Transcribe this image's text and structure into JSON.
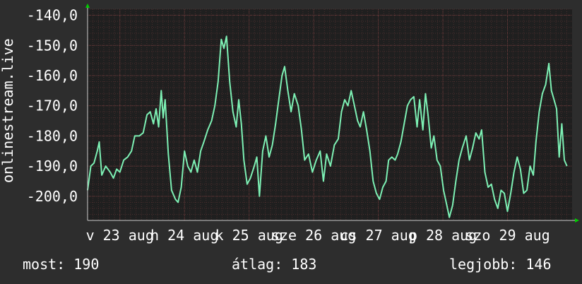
{
  "chart_data": {
    "type": "line",
    "title": "",
    "ylabel": "onlinestream.live",
    "xlabel": "",
    "ylim": [
      -208,
      -138
    ],
    "y_ticks": [
      "-140,0",
      "-150,0",
      "-160,0",
      "-170,0",
      "-180,0",
      "-190,0",
      "-200,0"
    ],
    "y_tick_values": [
      -140,
      -150,
      -160,
      -170,
      -180,
      -190,
      -200
    ],
    "x_range": [
      0,
      7.5
    ],
    "x_labels": [
      {
        "label": "v 23 aug",
        "x": 0.5
      },
      {
        "label": "h 24 aug",
        "x": 1.5
      },
      {
        "label": "k 25 aug",
        "x": 2.5
      },
      {
        "label": "sze 26 aug",
        "x": 3.5
      },
      {
        "label": "cs 27 aug",
        "x": 4.5
      },
      {
        "label": "p 28 aug",
        "x": 5.5
      },
      {
        "label": "szo 29 aug",
        "x": 6.5
      }
    ],
    "grid": true,
    "series": [
      {
        "color": "#7df0b4",
        "points": [
          [
            0.0,
            -198
          ],
          [
            0.05,
            -190
          ],
          [
            0.1,
            -189
          ],
          [
            0.15,
            -185
          ],
          [
            0.18,
            -182
          ],
          [
            0.22,
            -193
          ],
          [
            0.28,
            -190
          ],
          [
            0.35,
            -192
          ],
          [
            0.4,
            -194
          ],
          [
            0.45,
            -191
          ],
          [
            0.5,
            -192
          ],
          [
            0.56,
            -188
          ],
          [
            0.62,
            -187
          ],
          [
            0.68,
            -185
          ],
          [
            0.73,
            -180
          ],
          [
            0.8,
            -180
          ],
          [
            0.86,
            -179
          ],
          [
            0.92,
            -173
          ],
          [
            0.97,
            -172
          ],
          [
            1.02,
            -176
          ],
          [
            1.06,
            -171
          ],
          [
            1.1,
            -177
          ],
          [
            1.14,
            -165
          ],
          [
            1.17,
            -174
          ],
          [
            1.2,
            -168
          ],
          [
            1.25,
            -186
          ],
          [
            1.3,
            -198
          ],
          [
            1.36,
            -201
          ],
          [
            1.4,
            -202
          ],
          [
            1.45,
            -197
          ],
          [
            1.5,
            -185
          ],
          [
            1.55,
            -190
          ],
          [
            1.6,
            -192
          ],
          [
            1.65,
            -188
          ],
          [
            1.7,
            -192
          ],
          [
            1.75,
            -185
          ],
          [
            1.8,
            -182
          ],
          [
            1.86,
            -178
          ],
          [
            1.92,
            -175
          ],
          [
            1.97,
            -170
          ],
          [
            2.02,
            -162
          ],
          [
            2.07,
            -148
          ],
          [
            2.11,
            -151
          ],
          [
            2.15,
            -147
          ],
          [
            2.2,
            -162
          ],
          [
            2.25,
            -172
          ],
          [
            2.3,
            -177
          ],
          [
            2.34,
            -168
          ],
          [
            2.38,
            -176
          ],
          [
            2.42,
            -188
          ],
          [
            2.47,
            -196
          ],
          [
            2.52,
            -194
          ],
          [
            2.58,
            -190
          ],
          [
            2.62,
            -187
          ],
          [
            2.66,
            -200
          ],
          [
            2.71,
            -185
          ],
          [
            2.76,
            -180
          ],
          [
            2.81,
            -187
          ],
          [
            2.86,
            -183
          ],
          [
            2.91,
            -176
          ],
          [
            2.96,
            -168
          ],
          [
            3.01,
            -160
          ],
          [
            3.05,
            -157
          ],
          [
            3.1,
            -165
          ],
          [
            3.15,
            -172
          ],
          [
            3.2,
            -166
          ],
          [
            3.26,
            -170
          ],
          [
            3.31,
            -178
          ],
          [
            3.36,
            -188
          ],
          [
            3.42,
            -186
          ],
          [
            3.48,
            -192
          ],
          [
            3.54,
            -188
          ],
          [
            3.6,
            -185
          ],
          [
            3.65,
            -195
          ],
          [
            3.7,
            -186
          ],
          [
            3.76,
            -190
          ],
          [
            3.82,
            -183
          ],
          [
            3.88,
            -181
          ],
          [
            3.93,
            -172
          ],
          [
            3.98,
            -168
          ],
          [
            4.03,
            -170
          ],
          [
            4.08,
            -165
          ],
          [
            4.13,
            -170
          ],
          [
            4.18,
            -175
          ],
          [
            4.22,
            -177
          ],
          [
            4.27,
            -172
          ],
          [
            4.32,
            -178
          ],
          [
            4.37,
            -185
          ],
          [
            4.42,
            -195
          ],
          [
            4.47,
            -199
          ],
          [
            4.52,
            -201
          ],
          [
            4.57,
            -197
          ],
          [
            4.62,
            -195
          ],
          [
            4.66,
            -188
          ],
          [
            4.71,
            -187
          ],
          [
            4.76,
            -188
          ],
          [
            4.8,
            -186
          ],
          [
            4.85,
            -182
          ],
          [
            4.9,
            -176
          ],
          [
            4.95,
            -170
          ],
          [
            5.0,
            -168
          ],
          [
            5.05,
            -167
          ],
          [
            5.1,
            -177
          ],
          [
            5.14,
            -168
          ],
          [
            5.19,
            -178
          ],
          [
            5.23,
            -166
          ],
          [
            5.27,
            -173
          ],
          [
            5.32,
            -184
          ],
          [
            5.36,
            -180
          ],
          [
            5.41,
            -188
          ],
          [
            5.46,
            -190
          ],
          [
            5.51,
            -198
          ],
          [
            5.56,
            -203
          ],
          [
            5.6,
            -207
          ],
          [
            5.65,
            -203
          ],
          [
            5.7,
            -195
          ],
          [
            5.75,
            -188
          ],
          [
            5.8,
            -184
          ],
          [
            5.86,
            -180
          ],
          [
            5.91,
            -188
          ],
          [
            5.96,
            -184
          ],
          [
            6.01,
            -179
          ],
          [
            6.06,
            -181
          ],
          [
            6.1,
            -178
          ],
          [
            6.15,
            -192
          ],
          [
            6.2,
            -197
          ],
          [
            6.25,
            -196
          ],
          [
            6.3,
            -201
          ],
          [
            6.35,
            -204
          ],
          [
            6.4,
            -198
          ],
          [
            6.45,
            -199
          ],
          [
            6.5,
            -205
          ],
          [
            6.55,
            -199
          ],
          [
            6.6,
            -192
          ],
          [
            6.65,
            -187
          ],
          [
            6.7,
            -191
          ],
          [
            6.75,
            -199
          ],
          [
            6.8,
            -198
          ],
          [
            6.85,
            -190
          ],
          [
            6.9,
            -193
          ],
          [
            6.94,
            -182
          ],
          [
            6.99,
            -172
          ],
          [
            7.04,
            -166
          ],
          [
            7.09,
            -163
          ],
          [
            7.14,
            -156
          ],
          [
            7.18,
            -165
          ],
          [
            7.22,
            -168
          ],
          [
            7.26,
            -171
          ],
          [
            7.3,
            -187
          ],
          [
            7.34,
            -176
          ],
          [
            7.38,
            -188
          ],
          [
            7.42,
            -190
          ]
        ]
      }
    ]
  },
  "stats": {
    "current": "most: 190",
    "average": "átlag: 183",
    "best": "legjobb: 146"
  },
  "colors": {
    "background": "#2d2d2d",
    "plot_background": "#1f1f1f",
    "grid": "#4a2e2e",
    "axis_arrow": "#00cc00",
    "line": "#7df0b4",
    "text": "#ffffff"
  }
}
